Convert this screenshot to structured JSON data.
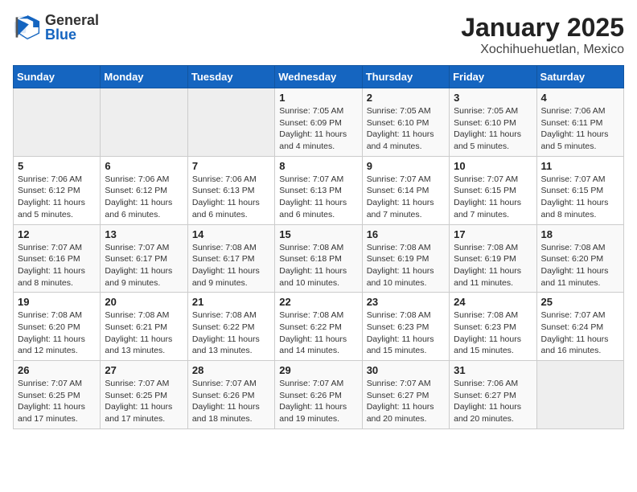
{
  "header": {
    "logo_general": "General",
    "logo_blue": "Blue",
    "title": "January 2025",
    "subtitle": "Xochihuehuetlan, Mexico"
  },
  "weekdays": [
    "Sunday",
    "Monday",
    "Tuesday",
    "Wednesday",
    "Thursday",
    "Friday",
    "Saturday"
  ],
  "weeks": [
    [
      {
        "day": "",
        "info": ""
      },
      {
        "day": "",
        "info": ""
      },
      {
        "day": "",
        "info": ""
      },
      {
        "day": "1",
        "info": "Sunrise: 7:05 AM\nSunset: 6:09 PM\nDaylight: 11 hours and 4 minutes."
      },
      {
        "day": "2",
        "info": "Sunrise: 7:05 AM\nSunset: 6:10 PM\nDaylight: 11 hours and 4 minutes."
      },
      {
        "day": "3",
        "info": "Sunrise: 7:05 AM\nSunset: 6:10 PM\nDaylight: 11 hours and 5 minutes."
      },
      {
        "day": "4",
        "info": "Sunrise: 7:06 AM\nSunset: 6:11 PM\nDaylight: 11 hours and 5 minutes."
      }
    ],
    [
      {
        "day": "5",
        "info": "Sunrise: 7:06 AM\nSunset: 6:12 PM\nDaylight: 11 hours and 5 minutes."
      },
      {
        "day": "6",
        "info": "Sunrise: 7:06 AM\nSunset: 6:12 PM\nDaylight: 11 hours and 6 minutes."
      },
      {
        "day": "7",
        "info": "Sunrise: 7:06 AM\nSunset: 6:13 PM\nDaylight: 11 hours and 6 minutes."
      },
      {
        "day": "8",
        "info": "Sunrise: 7:07 AM\nSunset: 6:13 PM\nDaylight: 11 hours and 6 minutes."
      },
      {
        "day": "9",
        "info": "Sunrise: 7:07 AM\nSunset: 6:14 PM\nDaylight: 11 hours and 7 minutes."
      },
      {
        "day": "10",
        "info": "Sunrise: 7:07 AM\nSunset: 6:15 PM\nDaylight: 11 hours and 7 minutes."
      },
      {
        "day": "11",
        "info": "Sunrise: 7:07 AM\nSunset: 6:15 PM\nDaylight: 11 hours and 8 minutes."
      }
    ],
    [
      {
        "day": "12",
        "info": "Sunrise: 7:07 AM\nSunset: 6:16 PM\nDaylight: 11 hours and 8 minutes."
      },
      {
        "day": "13",
        "info": "Sunrise: 7:07 AM\nSunset: 6:17 PM\nDaylight: 11 hours and 9 minutes."
      },
      {
        "day": "14",
        "info": "Sunrise: 7:08 AM\nSunset: 6:17 PM\nDaylight: 11 hours and 9 minutes."
      },
      {
        "day": "15",
        "info": "Sunrise: 7:08 AM\nSunset: 6:18 PM\nDaylight: 11 hours and 10 minutes."
      },
      {
        "day": "16",
        "info": "Sunrise: 7:08 AM\nSunset: 6:19 PM\nDaylight: 11 hours and 10 minutes."
      },
      {
        "day": "17",
        "info": "Sunrise: 7:08 AM\nSunset: 6:19 PM\nDaylight: 11 hours and 11 minutes."
      },
      {
        "day": "18",
        "info": "Sunrise: 7:08 AM\nSunset: 6:20 PM\nDaylight: 11 hours and 11 minutes."
      }
    ],
    [
      {
        "day": "19",
        "info": "Sunrise: 7:08 AM\nSunset: 6:20 PM\nDaylight: 11 hours and 12 minutes."
      },
      {
        "day": "20",
        "info": "Sunrise: 7:08 AM\nSunset: 6:21 PM\nDaylight: 11 hours and 13 minutes."
      },
      {
        "day": "21",
        "info": "Sunrise: 7:08 AM\nSunset: 6:22 PM\nDaylight: 11 hours and 13 minutes."
      },
      {
        "day": "22",
        "info": "Sunrise: 7:08 AM\nSunset: 6:22 PM\nDaylight: 11 hours and 14 minutes."
      },
      {
        "day": "23",
        "info": "Sunrise: 7:08 AM\nSunset: 6:23 PM\nDaylight: 11 hours and 15 minutes."
      },
      {
        "day": "24",
        "info": "Sunrise: 7:08 AM\nSunset: 6:23 PM\nDaylight: 11 hours and 15 minutes."
      },
      {
        "day": "25",
        "info": "Sunrise: 7:07 AM\nSunset: 6:24 PM\nDaylight: 11 hours and 16 minutes."
      }
    ],
    [
      {
        "day": "26",
        "info": "Sunrise: 7:07 AM\nSunset: 6:25 PM\nDaylight: 11 hours and 17 minutes."
      },
      {
        "day": "27",
        "info": "Sunrise: 7:07 AM\nSunset: 6:25 PM\nDaylight: 11 hours and 17 minutes."
      },
      {
        "day": "28",
        "info": "Sunrise: 7:07 AM\nSunset: 6:26 PM\nDaylight: 11 hours and 18 minutes."
      },
      {
        "day": "29",
        "info": "Sunrise: 7:07 AM\nSunset: 6:26 PM\nDaylight: 11 hours and 19 minutes."
      },
      {
        "day": "30",
        "info": "Sunrise: 7:07 AM\nSunset: 6:27 PM\nDaylight: 11 hours and 20 minutes."
      },
      {
        "day": "31",
        "info": "Sunrise: 7:06 AM\nSunset: 6:27 PM\nDaylight: 11 hours and 20 minutes."
      },
      {
        "day": "",
        "info": ""
      }
    ]
  ]
}
